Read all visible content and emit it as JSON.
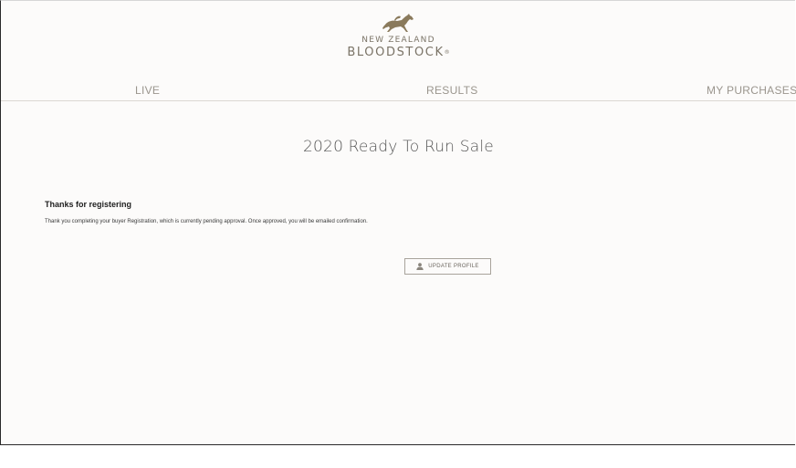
{
  "brand": {
    "line1": "NEW ZEALAND",
    "line2": "BLOODSTOCK",
    "trademark": "®",
    "logo_icon": "galloping-horse-logo"
  },
  "nav": {
    "live": "LIVE",
    "results": "RESULTS",
    "purchases": "MY PURCHASES"
  },
  "page": {
    "title": "2020 Ready To Run Sale"
  },
  "message": {
    "heading": "Thanks for registering",
    "body": "Thank you completing your buyer Registration, which is currently pending approval. Once approved, you will be emailed confirmation."
  },
  "actions": {
    "update_profile_label": "UPDATE PROFILE",
    "update_profile_icon": "user-icon"
  },
  "colors": {
    "brand": "#7a7366",
    "background": "#fcfbfa",
    "nav_text": "#9a958d"
  }
}
